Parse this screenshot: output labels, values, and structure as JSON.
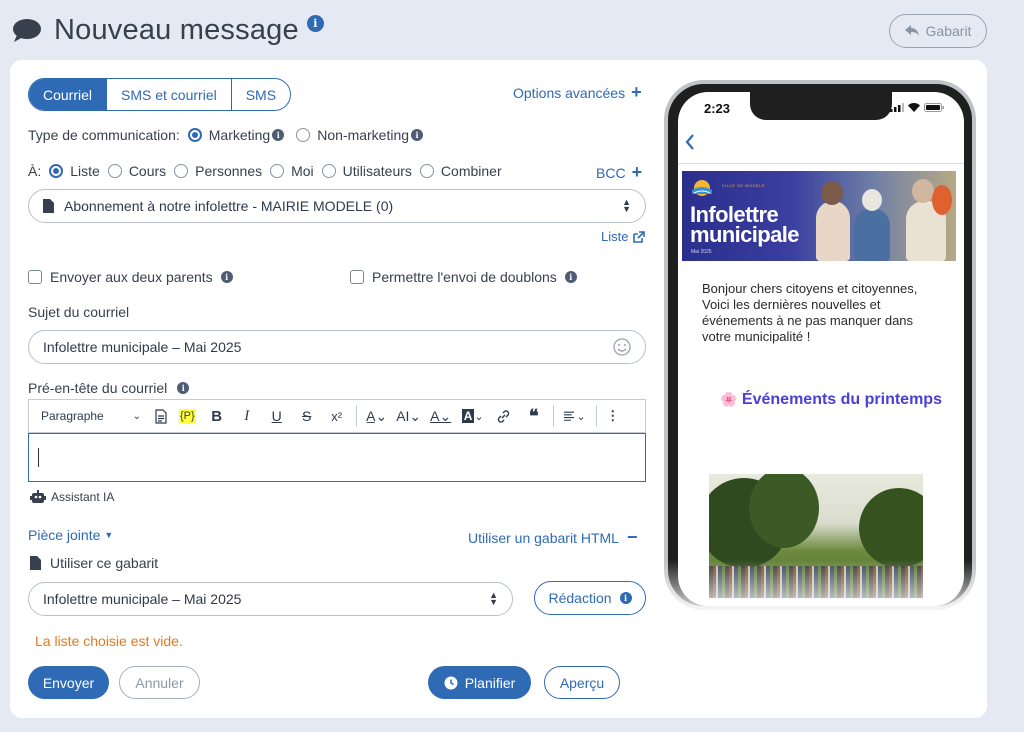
{
  "header": {
    "title": "Nouveau message",
    "gabarit_label": "Gabarit"
  },
  "tabs": [
    {
      "label": "Courriel"
    },
    {
      "label": "SMS et courriel"
    },
    {
      "label": "SMS"
    }
  ],
  "advanced_options": "Options avancées",
  "communication": {
    "label": "Type de communication:",
    "options": [
      {
        "label": "Marketing",
        "selected": true
      },
      {
        "label": "Non-marketing",
        "selected": false
      }
    ]
  },
  "recipients": {
    "label": "À:",
    "options": [
      {
        "label": "Liste",
        "selected": true
      },
      {
        "label": "Cours",
        "selected": false
      },
      {
        "label": "Personnes",
        "selected": false
      },
      {
        "label": "Moi",
        "selected": false
      },
      {
        "label": "Utilisateurs",
        "selected": false
      },
      {
        "label": "Combiner",
        "selected": false
      }
    ],
    "bcc_label": "BCC",
    "list_value": "Abonnement à notre infolettre - MAIRIE MODELE (0)",
    "list_link": "Liste"
  },
  "checkboxes": {
    "both_parents": "Envoyer aux deux parents",
    "allow_duplicates": "Permettre l'envoi de doublons"
  },
  "subject": {
    "label": "Sujet du courriel",
    "value": "Infolettre municipale – Mai 2025"
  },
  "preheader": {
    "label": "Pré-en-tête du courriel",
    "toolbar": {
      "paragraph": "Paragraphe",
      "placeholder_token": "{P}",
      "bold": "B",
      "italic": "I",
      "underline": "U",
      "strike": "S",
      "superscript": "x²"
    },
    "value": ""
  },
  "ai_assistant": "Assistant IA",
  "attachment": "Pièce jointe",
  "html_template_link": "Utiliser un gabarit HTML",
  "template": {
    "label": "Utiliser ce gabarit",
    "value": "Infolettre municipale – Mai 2025",
    "redaction_label": "Rédaction"
  },
  "error": "La liste choisie est vide.",
  "actions": {
    "send": "Envoyer",
    "cancel": "Annuler",
    "schedule": "Planifier",
    "preview": "Aperçu"
  },
  "preview": {
    "time": "2:23",
    "banner_small": "VILLE DE MODÈLE",
    "banner_title_1": "Infolettre",
    "banner_title_2": "municipale",
    "banner_date": "Mai 2025",
    "intro": "Bonjour chers citoyens et citoyennes, Voici les dernières nouvelles et événements à ne pas manquer dans votre municipalité !",
    "events_heading": "Événements du printemps",
    "events_emoji": "🌸"
  },
  "colors": {
    "primary": "#2f6ab5",
    "error": "#e07a1f",
    "background": "#e4e9f4"
  }
}
